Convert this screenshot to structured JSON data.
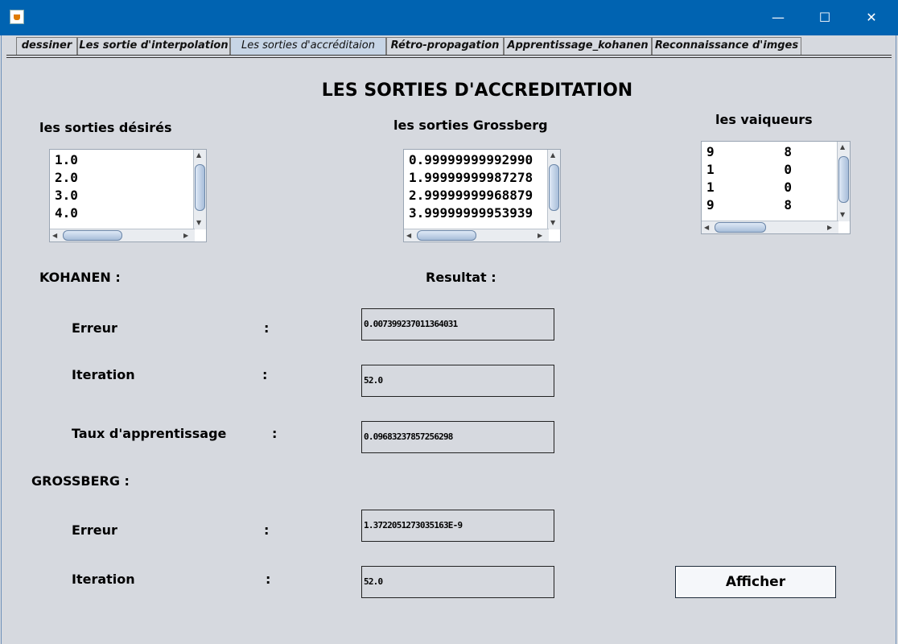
{
  "window": {
    "icon": "java-cup-icon",
    "controls": {
      "minimize": "—",
      "maximize": "☐",
      "close": "✕"
    }
  },
  "tabs": [
    {
      "label": "dessiner"
    },
    {
      "label": "Les sortie d'interpolation"
    },
    {
      "label": "Les sorties d'accréditaion"
    },
    {
      "label": "Rétro-propagation"
    },
    {
      "label": "Apprentissage_kohanen"
    },
    {
      "label": "Reconnaissance d'imges"
    }
  ],
  "active_tab": "Les sorties d'accréditaion",
  "title": "LES SORTIES D'ACCREDITATION",
  "lists": {
    "desired": {
      "label": "les sorties désirés",
      "content": "1.0\n2.0\n3.0\n4.0"
    },
    "grossberg": {
      "label": "les sorties Grossberg",
      "content": "0.99999999992990\n1.99999999987278\n2.99999999968879\n3.99999999953939"
    },
    "winners": {
      "label": "les vaiqueurs",
      "content": "9         8\n1         0\n1         0\n9         8"
    }
  },
  "sections": {
    "kohanen": "KOHANEN   :",
    "resultat": "Resultat   :",
    "grossberg": "GROSSBERG  :"
  },
  "kohanen": {
    "erreur_label": "Erreur",
    "erreur_value": "0.007399237011364031",
    "iteration_label": "Iteration",
    "iteration_value": "52.0",
    "taux_label": "Taux d'apprentissage",
    "taux_value": "0.09683237857256298"
  },
  "grossberg": {
    "erreur_label": "Erreur",
    "erreur_value": "1.3722051273035163E-9",
    "iteration_label": "Iteration",
    "iteration_value": "52.0"
  },
  "colon": ":",
  "button": {
    "label": "Afficher"
  }
}
